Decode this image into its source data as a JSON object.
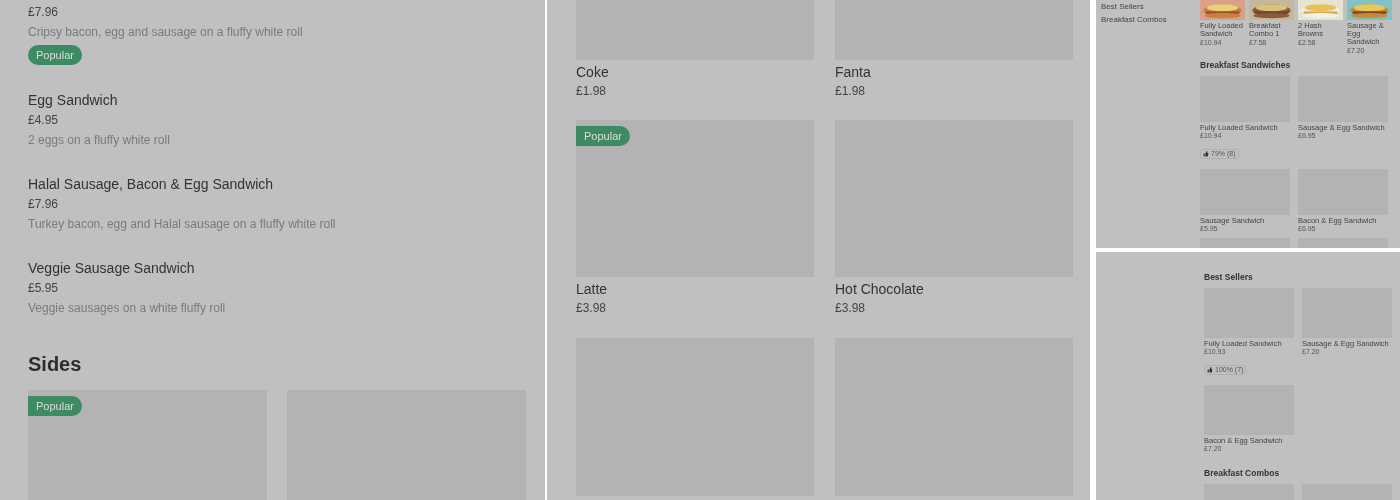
{
  "mobile_menu_view": {
    "items": [
      {
        "price": "£7.96",
        "description": "Cripsy bacon, egg and sausage on a fluffy white roll",
        "badge": "Popular"
      },
      {
        "name": "Egg Sandwich",
        "price": "£4.95",
        "description": "2 eggs on a fluffy white roll"
      },
      {
        "name": "Halal Sausage, Bacon & Egg Sandwich",
        "price": "£7.96",
        "description": "Turkey bacon, egg and Halal sausage on a fluffy white roll"
      },
      {
        "name": "Veggie Sausage Sandwich",
        "price": "£5.95",
        "description": "Veggie sausages on a white fluffy roll"
      }
    ],
    "section_title": "Sides",
    "cards": [
      {
        "kind": "product",
        "badge": "Popular"
      },
      {
        "kind": "image_only"
      }
    ]
  },
  "drinks_grid_view": {
    "rows": [
      [
        {
          "kind": "product",
          "name": "Coke",
          "price": "£1.98"
        },
        {
          "kind": "product",
          "name": "Fanta",
          "price": "£1.98"
        }
      ],
      [
        {
          "kind": "product",
          "name": "Latte",
          "price": "£3.98",
          "badge": "Popular"
        },
        {
          "kind": "product",
          "name": "Hot Chocolate",
          "price": "£3.98"
        }
      ],
      [
        {
          "kind": "image_only"
        },
        {
          "kind": "image_only"
        }
      ]
    ]
  },
  "desktop_view": {
    "sidebar": [
      {
        "label": "Best Sellers"
      },
      {
        "label": "Breakfast Combos"
      }
    ],
    "thumbnails": [
      {
        "name": "Fully Loaded Sandwich",
        "price": "£10.94"
      },
      {
        "name": "Breakfast Combo 1",
        "price": "£7.58"
      },
      {
        "name": "2 Hash Browns",
        "price": "£2.58"
      },
      {
        "name": "Sausage & Egg Sandwich",
        "price": "£7.20"
      }
    ],
    "section_title": "Breakfast Sandwiches",
    "cards": [
      {
        "kind": "product",
        "name": "Fully Loaded Sandwich",
        "price": "£10.94",
        "rating": "79% (8)"
      },
      {
        "kind": "product",
        "name": "Sausage & Egg Sandwich",
        "price": "£6.95"
      },
      {
        "kind": "product",
        "name": "Sausage Sandwich",
        "price": "£5.95"
      },
      {
        "kind": "product",
        "name": "Bacon & Egg Sandwich",
        "price": "£6.95"
      },
      {
        "kind": "image_only"
      },
      {
        "kind": "image_only"
      }
    ]
  },
  "desktop_view_lower": {
    "sections": [
      {
        "title": "Best Sellers",
        "cards": [
          {
            "kind": "product",
            "name": "Fully Loaded Sandwich",
            "price": "£10.93",
            "rating": "100% (7)"
          },
          {
            "kind": "product",
            "name": "Sausage & Egg Sandwich",
            "price": "£7.20"
          },
          {
            "kind": "product",
            "name": "Bacon & Egg Sandwich",
            "price": "£7.20"
          }
        ]
      },
      {
        "title": "Breakfast Combos",
        "cards": [
          {
            "kind": "image_only"
          },
          {
            "kind": "image_only"
          }
        ]
      }
    ]
  }
}
